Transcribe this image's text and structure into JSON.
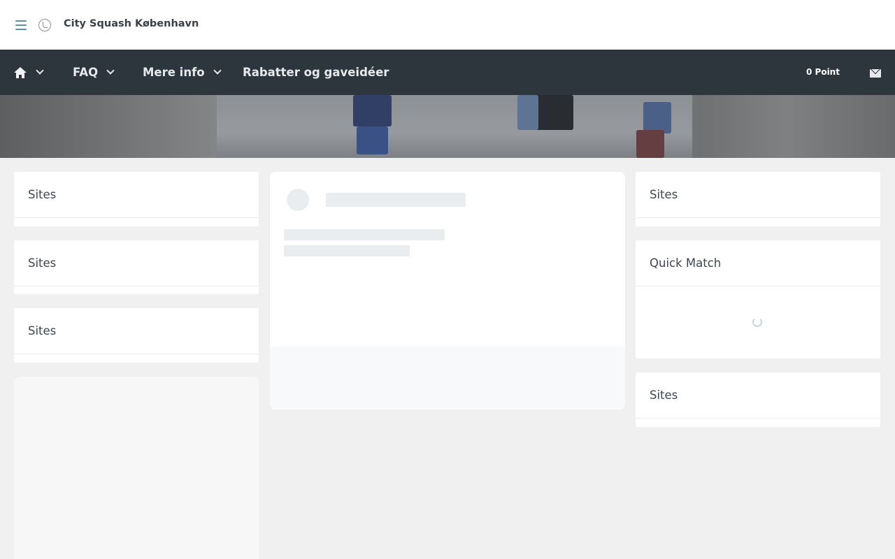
{
  "header": {
    "brand": "City Squash København"
  },
  "nav": {
    "faq": "FAQ",
    "more_info": "Mere info",
    "discounts": "Rabatter og gaveidéer",
    "points": "0 Point"
  },
  "left_column": {
    "cards": [
      {
        "title": "Sites"
      },
      {
        "title": "Sites"
      },
      {
        "title": "Sites"
      }
    ]
  },
  "right_column": {
    "cards": [
      {
        "title": "Sites"
      },
      {
        "title": "Quick Match"
      },
      {
        "title": "Sites"
      }
    ]
  },
  "icons": {
    "menu": "hamburger-menu-icon",
    "logo": "club-logo-icon",
    "home": "home-icon",
    "chevron": "chevron-down-icon",
    "mail": "mail-icon",
    "loading": "loading-spinner-icon"
  },
  "colors": {
    "navbar_bg": "#2d353d",
    "page_bg": "#f0f0f0",
    "accent": "#5b8fb9"
  }
}
